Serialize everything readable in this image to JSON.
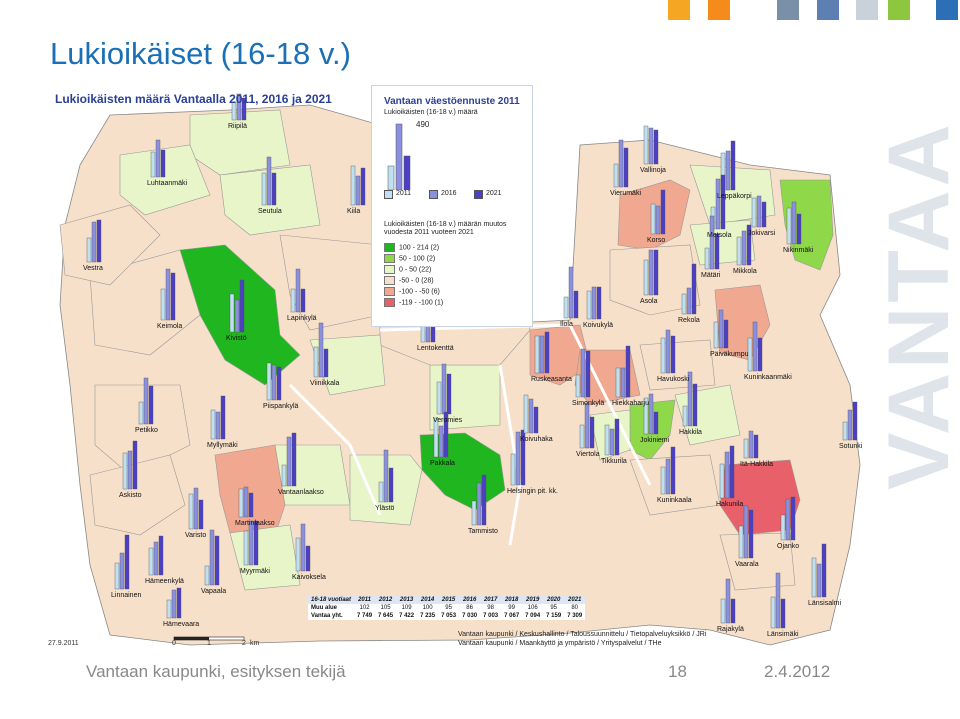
{
  "title": "Lukioikäiset  (16-18 v.)",
  "corner_colors": [
    "#f5a623",
    "#f48b1b",
    "#7a8fa8",
    "#5e7fb1",
    "#c9d2db",
    "#8dc63f",
    "#2d6fb7"
  ],
  "map": {
    "title": "Lukioikäisten määrä Vantaalla 2011, 2016 ja 2021",
    "date": "27.9.2011",
    "scale": {
      "ticks": [
        "0",
        "1",
        "2"
      ],
      "unit": "km"
    },
    "credits": [
      "Vantaan kaupunki / Keskushallinto / Taloussuunnittelu / Tietopalveluyksikkö / JRi",
      "Vantaan kaupunki / Maankäyttö ja ympäristö / Yrityspalvelut / THe"
    ],
    "colors": {
      "class_100_214": "#1fb61f",
      "class_50_100": "#8fd84a",
      "class_0_50": "#e8f5c8",
      "class_m50_0": "#f7e0c9",
      "class_m100_m50": "#f0a890",
      "class_m119_m100": "#e8606a",
      "bar_2011": "#bfe0f0",
      "bar_2016": "#8a8fe0",
      "bar_2021": "#4b3fc6",
      "water": "#ffffff"
    }
  },
  "legend": {
    "heading": "Vantaan väestöennuste 2011",
    "subheading": "Lukioikäisten (16-18 v.) määrä",
    "max_value": "490",
    "years": [
      "2011",
      "2016",
      "2021"
    ],
    "change_heading": "Lukioikäisten (16-18 v.) määrän muutos vuodesta 2011 vuoteen 2021",
    "classes": [
      {
        "label": "100 -  214",
        "count": "(2)",
        "color": "#1fb61f"
      },
      {
        "label": "50 -  100",
        "count": "(2)",
        "color": "#8fd84a"
      },
      {
        "label": "0 -   50",
        "count": "(22)",
        "color": "#e8f5c8"
      },
      {
        "label": "-50 -    0",
        "count": "(28)",
        "color": "#f7e0c9"
      },
      {
        "label": "-100 -  -50",
        "count": "(6)",
        "color": "#f0a890"
      },
      {
        "label": "-119 - -100",
        "count": "(1)",
        "color": "#e8606a"
      }
    ]
  },
  "places": [
    "Riipilä",
    "Luhtaanmäki",
    "Seutula",
    "Kiila",
    "Vestra",
    "Keimola",
    "Kivistö",
    "Lapinkylä",
    "Viinikkala",
    "Piispankylä",
    "Petikko",
    "Myllymäki",
    "Askisto",
    "Vantaanlaakso",
    "Martinlaakso",
    "Varisto",
    "Ylästö",
    "Hämeenkylä",
    "Myyrmäki",
    "Vapaala",
    "Linnainen",
    "Kaivoksela",
    "Hämevaara",
    "Lentokenttä",
    "Veromies",
    "Pakkala",
    "Tammisto",
    "Helsingin pit. kk.",
    "Koivuhaka",
    "Viertola",
    "Tikkurila",
    "Ruskeasanta",
    "Simonkylä",
    "Hiekkaharju",
    "Jokiniemi",
    "Ilola",
    "Koivukylä",
    "Havukoski",
    "Hakkila",
    "Kuninkaala",
    "Hakunila",
    "Itä-Hakkila",
    "Päiväkumpu",
    "Kuninkaanmäki",
    "Sotunki",
    "Ojanko",
    "Vaarala",
    "Länsisalmi",
    "Rajakylä",
    "Länsimäki",
    "Vallinoja",
    "Vierumäki",
    "Korso",
    "Leppäkorpi",
    "Metsola",
    "Jokivarsi",
    "Nikinmäki",
    "Mätäri",
    "Mikkola",
    "Asola",
    "Rekola"
  ],
  "table": {
    "header": [
      "16-18 vuotiaat",
      "2011",
      "2012",
      "2013",
      "2014",
      "2015",
      "2016",
      "2017",
      "2018",
      "2019",
      "2020",
      "2021"
    ],
    "rows": [
      [
        "Muu alue",
        "102",
        "105",
        "109",
        "100",
        "95",
        "86",
        "98",
        "99",
        "106",
        "95",
        "80"
      ],
      [
        "Vantaa yht.",
        "7 749",
        "7 645",
        "7 422",
        "7 235",
        "7 053",
        "7 030",
        "7 003",
        "7 067",
        "7 094",
        "7 159",
        "7 309"
      ]
    ]
  },
  "footer": {
    "left": "Vantaan kaupunki, esityksen tekijä",
    "page": "18",
    "date": "2.4.2012"
  },
  "watermark": "VANTAA"
}
